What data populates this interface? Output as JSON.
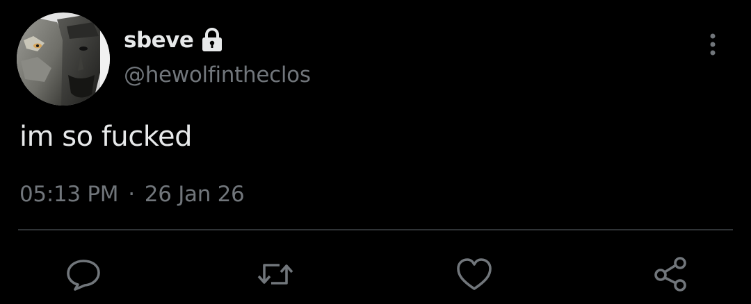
{
  "user": {
    "display_name": "sbeve",
    "handle": "@hewolfintheclos",
    "protected_icon": "lock-icon",
    "avatar": "profile-photo-wolf-face"
  },
  "tweet": {
    "text": "im so fucked",
    "time": "05:13 PM",
    "separator": "·",
    "date": "26 Jan 26"
  },
  "actions": {
    "reply_icon": "reply-icon",
    "retweet_icon": "retweet-icon",
    "like_icon": "like-icon",
    "share_icon": "share-icon"
  },
  "menu": {
    "more_icon": "more-options-icon"
  },
  "colors": {
    "background": "#000000",
    "primary_text": "#e7e9ea",
    "secondary_text": "#71767b",
    "divider": "#2f3336"
  }
}
